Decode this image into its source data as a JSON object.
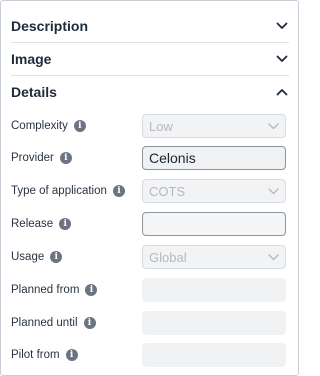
{
  "sections": {
    "description": {
      "title": "Description",
      "expanded": false
    },
    "image": {
      "title": "Image",
      "expanded": false
    },
    "details": {
      "title": "Details",
      "expanded": true
    }
  },
  "details": {
    "complexity": {
      "label": "Complexity",
      "value": "Low",
      "type": "select",
      "disabled": true
    },
    "provider": {
      "label": "Provider",
      "value": "Celonis",
      "type": "input"
    },
    "type_of_application": {
      "label": "Type of application",
      "value": "COTS",
      "type": "select",
      "disabled": true
    },
    "release": {
      "label": "Release",
      "value": "",
      "type": "input"
    },
    "usage": {
      "label": "Usage",
      "value": "Global",
      "type": "select",
      "disabled": true
    },
    "planned_from": {
      "label": "Planned from",
      "value": "",
      "type": "date"
    },
    "planned_until": {
      "label": "Planned until",
      "value": "",
      "type": "date"
    },
    "pilot_from": {
      "label": "Pilot from",
      "value": "",
      "type": "date"
    }
  },
  "icons": {
    "info": "info-icon",
    "chevron_down": "chevron-down-icon",
    "chevron_up": "chevron-up-icon"
  },
  "colors": {
    "text": "#1d2b3c",
    "disabled_text": "#b4b9c1",
    "border": "#d8dce2",
    "info_icon": "#6b7480"
  }
}
